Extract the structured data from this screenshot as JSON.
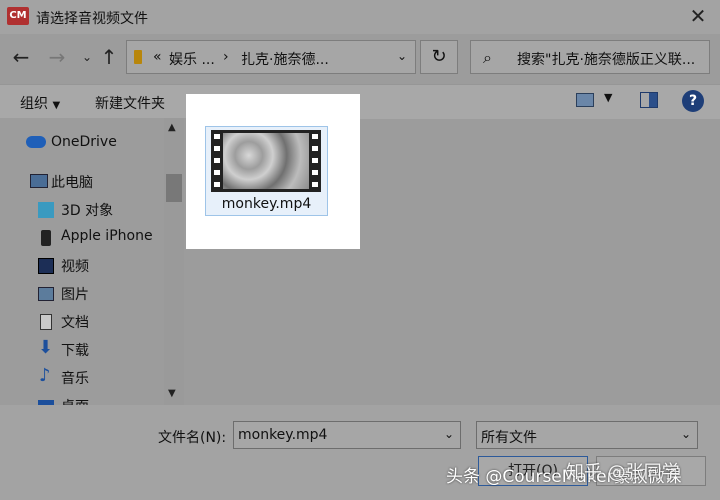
{
  "window": {
    "title": "请选择音视频文件",
    "app_icon": "CM"
  },
  "address": {
    "crumbs": [
      "«",
      "娱乐 ...",
      "›",
      "扎克·施奈德..."
    ],
    "search_placeholder": "搜索\"扎克·施奈德版正义联..."
  },
  "toolbar": {
    "organize": "组织",
    "new_folder": "新建文件夹"
  },
  "nav": {
    "items": [
      {
        "label": "OneDrive"
      },
      {
        "label": "此电脑"
      },
      {
        "label": "3D 对象"
      },
      {
        "label": "Apple iPhone"
      },
      {
        "label": "视频"
      },
      {
        "label": "图片"
      },
      {
        "label": "文档"
      },
      {
        "label": "下载"
      },
      {
        "label": "音乐"
      },
      {
        "label": "桌面"
      }
    ]
  },
  "files": [
    {
      "name": "monkey.mp4"
    }
  ],
  "bottom": {
    "filename_label": "文件名(N):",
    "filename_value": "monkey.mp4",
    "filetype_value": "所有文件",
    "open_button": "打开(O)"
  },
  "watermark": {
    "left": "头条 @CourseMaker豪叔微课",
    "right": "知乎 @张同学"
  },
  "colors": {
    "accent": "#1e3e78",
    "selection_fill": "#e7f0fa",
    "selection_border": "#9ec4e8"
  }
}
